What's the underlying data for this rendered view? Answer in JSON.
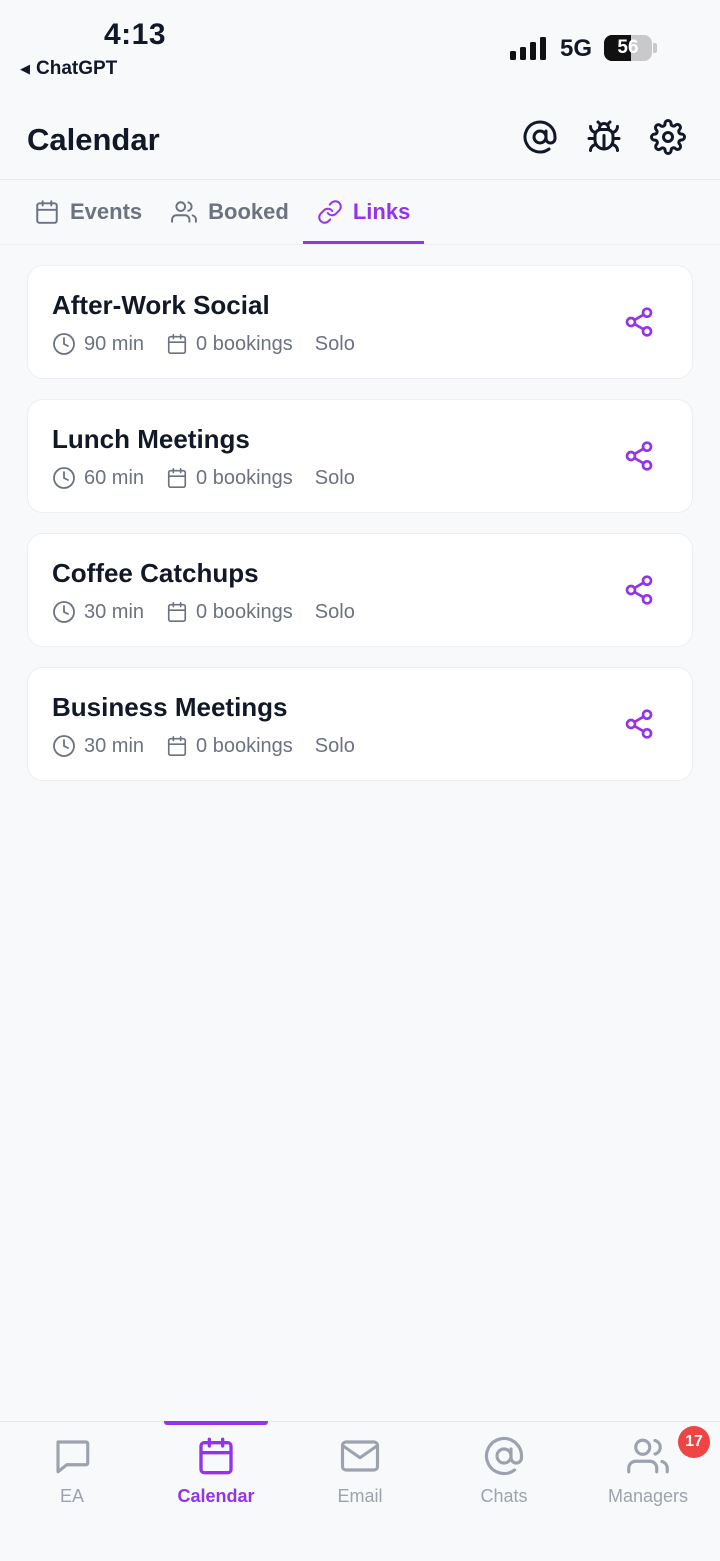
{
  "status_bar": {
    "time": "4:13",
    "back_app": "ChatGPT",
    "network": "5G",
    "battery": "56"
  },
  "header": {
    "title": "Calendar",
    "icons": [
      "at-icon",
      "bug-icon",
      "gear-icon"
    ]
  },
  "tabs": [
    {
      "label": "Events",
      "icon": "calendar-icon",
      "active": false
    },
    {
      "label": "Booked",
      "icon": "users-icon",
      "active": false
    },
    {
      "label": "Links",
      "icon": "link-icon",
      "active": true
    }
  ],
  "links": [
    {
      "title": "After-Work Social",
      "duration": "90 min",
      "bookings": "0 bookings",
      "type": "Solo"
    },
    {
      "title": "Lunch Meetings",
      "duration": "60 min",
      "bookings": "0 bookings",
      "type": "Solo"
    },
    {
      "title": "Coffee Catchups",
      "duration": "30 min",
      "bookings": "0 bookings",
      "type": "Solo"
    },
    {
      "title": "Business Meetings",
      "duration": "30 min",
      "bookings": "0 bookings",
      "type": "Solo"
    }
  ],
  "bottom_nav": [
    {
      "label": "EA",
      "icon": "chat-bubble-icon",
      "active": false
    },
    {
      "label": "Calendar",
      "icon": "calendar-icon",
      "active": true
    },
    {
      "label": "Email",
      "icon": "mail-icon",
      "active": false
    },
    {
      "label": "Chats",
      "icon": "at-icon",
      "active": false
    },
    {
      "label": "Managers",
      "icon": "users-icon",
      "active": false,
      "badge": "17"
    }
  ],
  "colors": {
    "accent": "#9333ea",
    "background": "#f8f9fb",
    "muted": "#6b7280",
    "badge": "#ef4444"
  }
}
